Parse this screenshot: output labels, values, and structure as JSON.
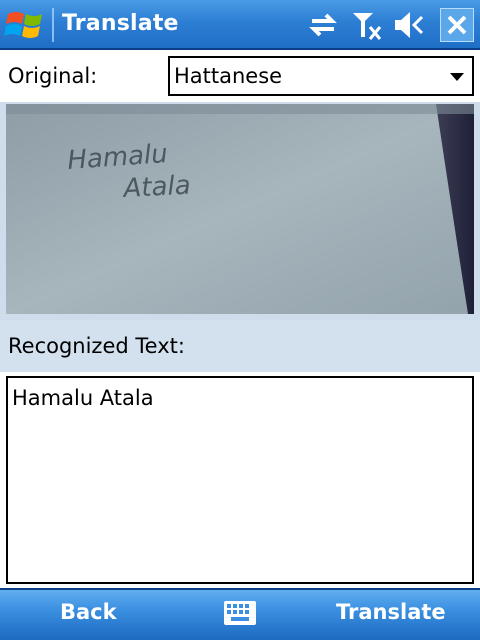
{
  "titlebar": {
    "title": "Translate",
    "icons": [
      "start-windows-flag-icon",
      "connectivity-arrows-icon",
      "no-signal-icon",
      "speaker-icon",
      "close-icon"
    ]
  },
  "language": {
    "label": "Original:",
    "selected": "Hattanese"
  },
  "preview": {
    "handwriting_line1": "Hamalu",
    "handwriting_line2": "Atala"
  },
  "recognized": {
    "label": "Recognized Text:",
    "value": "Hamalu Atala"
  },
  "menubar": {
    "left_label": "Back",
    "right_label": "Translate",
    "center_icon": "keyboard-icon"
  },
  "colors": {
    "titlebar": "#2d7fd4",
    "menubar": "#3a8fe0",
    "label_bar": "#d3e0ee"
  }
}
